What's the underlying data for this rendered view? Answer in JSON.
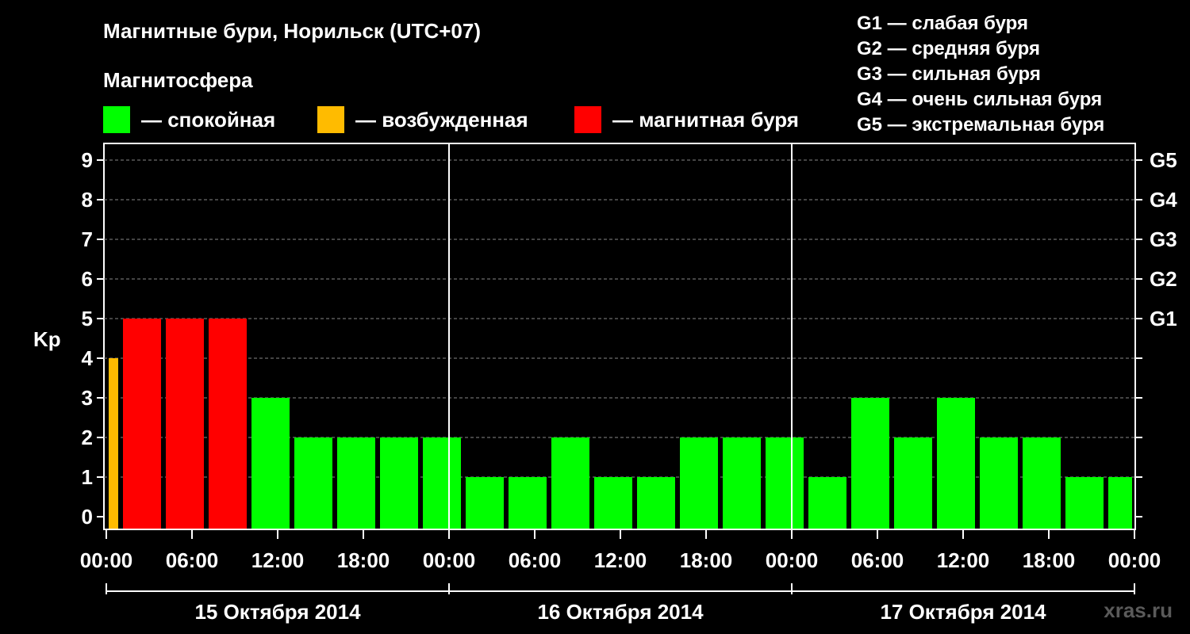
{
  "title": "Магнитные бури, Норильск (UTC+07)",
  "magnetosphere_heading": "Магнитосфера",
  "legend": [
    {
      "label": "— спокойная",
      "color": "#00ff00"
    },
    {
      "label": "— возбужденная",
      "color": "#ffbb00"
    },
    {
      "label": "— магнитная буря",
      "color": "#ff0000"
    }
  ],
  "g_scale": [
    "G1 — слабая буря",
    "G2 — средняя буря",
    "G3 — сильная буря",
    "G4 — очень сильная буря",
    "G5 — экстремальная буря"
  ],
  "watermark": "xras.ru",
  "chart_data": {
    "type": "bar",
    "ylabel": "Kp",
    "ylim": [
      0,
      9
    ],
    "y_ticks": [
      "0",
      "1",
      "2",
      "3",
      "4",
      "5",
      "6",
      "7",
      "8",
      "9"
    ],
    "right_ticks": [
      {
        "value": 5,
        "label": "G1"
      },
      {
        "value": 6,
        "label": "G2"
      },
      {
        "value": 7,
        "label": "G3"
      },
      {
        "value": 8,
        "label": "G4"
      },
      {
        "value": 9,
        "label": "G5"
      }
    ],
    "x_tick_labels": [
      "00:00",
      "06:00",
      "12:00",
      "18:00",
      "00:00",
      "06:00",
      "12:00",
      "18:00",
      "00:00",
      "06:00",
      "12:00",
      "18:00",
      "00:00"
    ],
    "days": [
      "15 Октября 2014",
      "16 Октября 2014",
      "17 Октября 2014"
    ],
    "grid": "dashed horizontal",
    "colors": {
      "quiet": "#00ff00",
      "active": "#ffbb00",
      "storm": "#ff0000"
    },
    "bars": [
      {
        "start_hour": 0,
        "end_hour": 1,
        "value": 4,
        "level": "active"
      },
      {
        "start_hour": 1,
        "end_hour": 4,
        "value": 5,
        "level": "storm"
      },
      {
        "start_hour": 4,
        "end_hour": 7,
        "value": 5,
        "level": "storm"
      },
      {
        "start_hour": 7,
        "end_hour": 10,
        "value": 5,
        "level": "storm"
      },
      {
        "start_hour": 10,
        "end_hour": 13,
        "value": 3,
        "level": "quiet"
      },
      {
        "start_hour": 13,
        "end_hour": 16,
        "value": 2,
        "level": "quiet"
      },
      {
        "start_hour": 16,
        "end_hour": 19,
        "value": 2,
        "level": "quiet"
      },
      {
        "start_hour": 19,
        "end_hour": 22,
        "value": 2,
        "level": "quiet"
      },
      {
        "start_hour": 22,
        "end_hour": 25,
        "value": 2,
        "level": "quiet"
      },
      {
        "start_hour": 25,
        "end_hour": 28,
        "value": 1,
        "level": "quiet"
      },
      {
        "start_hour": 28,
        "end_hour": 31,
        "value": 1,
        "level": "quiet"
      },
      {
        "start_hour": 31,
        "end_hour": 34,
        "value": 2,
        "level": "quiet"
      },
      {
        "start_hour": 34,
        "end_hour": 37,
        "value": 1,
        "level": "quiet"
      },
      {
        "start_hour": 37,
        "end_hour": 40,
        "value": 1,
        "level": "quiet"
      },
      {
        "start_hour": 40,
        "end_hour": 43,
        "value": 2,
        "level": "quiet"
      },
      {
        "start_hour": 43,
        "end_hour": 46,
        "value": 2,
        "level": "quiet"
      },
      {
        "start_hour": 46,
        "end_hour": 49,
        "value": 2,
        "level": "quiet"
      },
      {
        "start_hour": 49,
        "end_hour": 52,
        "value": 1,
        "level": "quiet"
      },
      {
        "start_hour": 52,
        "end_hour": 55,
        "value": 3,
        "level": "quiet"
      },
      {
        "start_hour": 55,
        "end_hour": 58,
        "value": 2,
        "level": "quiet"
      },
      {
        "start_hour": 58,
        "end_hour": 61,
        "value": 3,
        "level": "quiet"
      },
      {
        "start_hour": 61,
        "end_hour": 64,
        "value": 2,
        "level": "quiet"
      },
      {
        "start_hour": 64,
        "end_hour": 67,
        "value": 2,
        "level": "quiet"
      },
      {
        "start_hour": 67,
        "end_hour": 70,
        "value": 1,
        "level": "quiet"
      },
      {
        "start_hour": 70,
        "end_hour": 72,
        "value": 1,
        "level": "quiet"
      }
    ]
  }
}
